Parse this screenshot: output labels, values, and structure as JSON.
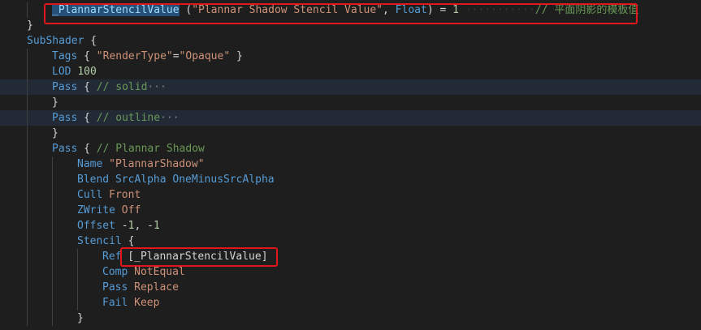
{
  "editor": {
    "lines": [
      {
        "indent": 1,
        "highlight": false,
        "tokens": [
          {
            "t": "_PlannarStencilValue",
            "c": "tok-id tok-sel"
          },
          {
            "t": " (",
            "c": "tok-pl"
          },
          {
            "t": "\"Plannar Shadow Stencil Value\"",
            "c": "tok-str"
          },
          {
            "t": ", ",
            "c": "tok-pl"
          },
          {
            "t": "Float",
            "c": "tok-kw"
          },
          {
            "t": ") = ",
            "c": "tok-pl"
          },
          {
            "t": "1",
            "c": "tok-num"
          },
          {
            "t": " ···········",
            "c": "ws"
          },
          {
            "t": "// 平面阴影的模板值",
            "c": "tok-cm"
          }
        ]
      },
      {
        "indent": 0,
        "highlight": false,
        "tokens": [
          {
            "t": "}",
            "c": "tok-pl"
          }
        ]
      },
      {
        "indent": 0,
        "highlight": false,
        "tokens": [
          {
            "t": "SubShader",
            "c": "tok-kw"
          },
          {
            "t": " {",
            "c": "tok-pl"
          }
        ]
      },
      {
        "indent": 1,
        "highlight": false,
        "tokens": [
          {
            "t": "Tags",
            "c": "tok-kw"
          },
          {
            "t": " { ",
            "c": "tok-pl"
          },
          {
            "t": "\"RenderType\"",
            "c": "tok-str"
          },
          {
            "t": "=",
            "c": "tok-pl"
          },
          {
            "t": "\"Opaque\"",
            "c": "tok-str"
          },
          {
            "t": " }",
            "c": "tok-pl"
          }
        ]
      },
      {
        "indent": 1,
        "highlight": false,
        "tokens": [
          {
            "t": "LOD",
            "c": "tok-kw"
          },
          {
            "t": " ",
            "c": "tok-pl"
          },
          {
            "t": "100",
            "c": "tok-num"
          }
        ]
      },
      {
        "indent": 1,
        "highlight": true,
        "tokens": [
          {
            "t": "Pass",
            "c": "tok-kw"
          },
          {
            "t": " { ",
            "c": "tok-pl"
          },
          {
            "t": "// solid",
            "c": "tok-cm"
          },
          {
            "t": "···",
            "c": "fold"
          }
        ]
      },
      {
        "indent": 1,
        "highlight": false,
        "tokens": [
          {
            "t": "}",
            "c": "tok-pl"
          }
        ]
      },
      {
        "indent": 1,
        "highlight": true,
        "tokens": [
          {
            "t": "Pass",
            "c": "tok-kw"
          },
          {
            "t": " { ",
            "c": "tok-pl"
          },
          {
            "t": "// outline",
            "c": "tok-cm"
          },
          {
            "t": "···",
            "c": "fold"
          }
        ]
      },
      {
        "indent": 1,
        "highlight": false,
        "tokens": [
          {
            "t": "}",
            "c": "tok-pl"
          }
        ]
      },
      {
        "indent": 1,
        "highlight": false,
        "tokens": [
          {
            "t": "Pass",
            "c": "tok-kw"
          },
          {
            "t": " { ",
            "c": "tok-pl"
          },
          {
            "t": "// Plannar Shadow",
            "c": "tok-cm"
          }
        ]
      },
      {
        "indent": 2,
        "highlight": false,
        "tokens": [
          {
            "t": "Name",
            "c": "tok-kw"
          },
          {
            "t": " ",
            "c": "tok-pl"
          },
          {
            "t": "\"PlannarShadow\"",
            "c": "tok-str"
          }
        ]
      },
      {
        "indent": 2,
        "highlight": false,
        "tokens": [
          {
            "t": "Blend",
            "c": "tok-kw"
          },
          {
            "t": " ",
            "c": "tok-pl"
          },
          {
            "t": "SrcAlpha OneMinusSrcAlpha",
            "c": "tok-kw"
          }
        ]
      },
      {
        "indent": 2,
        "highlight": false,
        "tokens": [
          {
            "t": "Cull",
            "c": "tok-kw"
          },
          {
            "t": " ",
            "c": "tok-pl"
          },
          {
            "t": "Front",
            "c": "tok-str"
          }
        ]
      },
      {
        "indent": 2,
        "highlight": false,
        "tokens": [
          {
            "t": "ZWrite",
            "c": "tok-kw"
          },
          {
            "t": " ",
            "c": "tok-pl"
          },
          {
            "t": "Off",
            "c": "tok-str"
          }
        ]
      },
      {
        "indent": 2,
        "highlight": false,
        "tokens": [
          {
            "t": "Offset",
            "c": "tok-kw"
          },
          {
            "t": " -",
            "c": "tok-pl"
          },
          {
            "t": "1",
            "c": "tok-num"
          },
          {
            "t": ", -",
            "c": "tok-pl"
          },
          {
            "t": "1",
            "c": "tok-num"
          }
        ]
      },
      {
        "indent": 2,
        "highlight": false,
        "tokens": [
          {
            "t": "Stencil",
            "c": "tok-kw"
          },
          {
            "t": " {",
            "c": "tok-pl"
          }
        ]
      },
      {
        "indent": 3,
        "highlight": false,
        "tokens": [
          {
            "t": "Ref",
            "c": "tok-kw"
          },
          {
            "t": " [",
            "c": "tok-pl"
          },
          {
            "t": "_PlannarStencilValue",
            "c": "tok-pl"
          },
          {
            "t": "]",
            "c": "tok-pl"
          }
        ]
      },
      {
        "indent": 3,
        "highlight": false,
        "tokens": [
          {
            "t": "Comp",
            "c": "tok-kw"
          },
          {
            "t": " ",
            "c": "tok-pl"
          },
          {
            "t": "NotEqual",
            "c": "tok-str"
          }
        ]
      },
      {
        "indent": 3,
        "highlight": false,
        "tokens": [
          {
            "t": "Pass",
            "c": "tok-kw"
          },
          {
            "t": " ",
            "c": "tok-pl"
          },
          {
            "t": "Replace",
            "c": "tok-str"
          }
        ]
      },
      {
        "indent": 3,
        "highlight": false,
        "tokens": [
          {
            "t": "Fail",
            "c": "tok-kw"
          },
          {
            "t": " ",
            "c": "tok-pl"
          },
          {
            "t": "Keep",
            "c": "tok-str"
          }
        ]
      },
      {
        "indent": 2,
        "highlight": false,
        "tokens": [
          {
            "t": "}",
            "c": "tok-pl"
          }
        ]
      }
    ]
  },
  "colors": {
    "background": "#1e1e1e",
    "keyword": "#569cd6",
    "string": "#ce9178",
    "number": "#b5cea8",
    "comment": "#6a9955",
    "annotation_box": "#e0181b"
  }
}
